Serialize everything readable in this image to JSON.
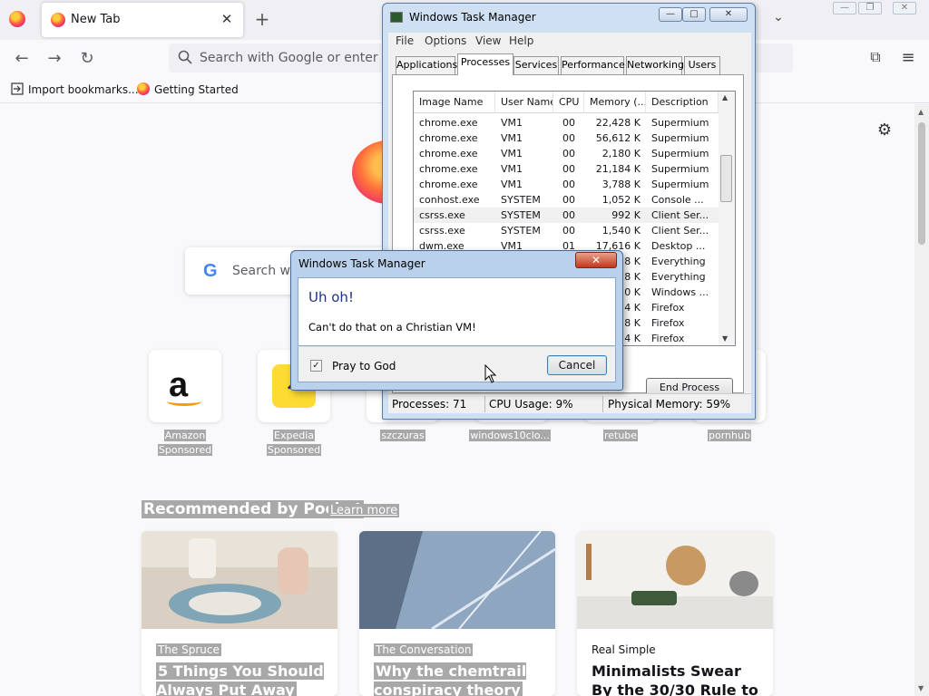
{
  "browser": {
    "tab": {
      "title": "New Tab",
      "close_icon": "close-icon"
    },
    "urlbar": {
      "placeholder": "Search with Google or enter addr"
    },
    "bookmarks": [
      {
        "label": "Import bookmarks...",
        "icon": "import-icon"
      },
      {
        "label": "Getting Started",
        "icon": "firefox-icon"
      }
    ]
  },
  "newtab": {
    "search_placeholder": "Search wi",
    "tiles": [
      {
        "label": "Amazon",
        "sub": "Sponsored"
      },
      {
        "label": "Expedia",
        "sub": "Sponsored"
      },
      {
        "label": "szczuras"
      },
      {
        "label": "windows10clo..."
      },
      {
        "label": "retube"
      },
      {
        "label": "pornhub"
      }
    ],
    "pocket_heading": "Recommended by Pocket",
    "learn_more": "Learn more",
    "cards": [
      {
        "source": "The Spruce",
        "title": "5 Things You Should Always Put Away"
      },
      {
        "source": "The Conversation",
        "title": "Why the chemtrail conspiracy theory"
      },
      {
        "source": "Real Simple",
        "title": "Minimalists Swear By the 30/30 Rule to Cut"
      }
    ]
  },
  "task_manager": {
    "title": "Windows Task Manager",
    "menus": [
      "File",
      "Options",
      "View",
      "Help"
    ],
    "tabs": [
      "Applications",
      "Processes",
      "Services",
      "Performance",
      "Networking",
      "Users"
    ],
    "active_tab": "Processes",
    "columns": [
      "Image Name",
      "User Name",
      "CPU",
      "Memory (...",
      "Description"
    ],
    "rows": [
      [
        "chrome.exe",
        "VM1",
        "00",
        "22,428 K",
        "Supermium"
      ],
      [
        "chrome.exe",
        "VM1",
        "00",
        "56,612 K",
        "Supermium"
      ],
      [
        "chrome.exe",
        "VM1",
        "00",
        "2,180 K",
        "Supermium"
      ],
      [
        "chrome.exe",
        "VM1",
        "00",
        "21,184 K",
        "Supermium"
      ],
      [
        "chrome.exe",
        "VM1",
        "00",
        "3,788 K",
        "Supermium"
      ],
      [
        "conhost.exe",
        "SYSTEM",
        "00",
        "1,052 K",
        "Console ..."
      ],
      [
        "csrss.exe",
        "SYSTEM",
        "00",
        "992 K",
        "Client Ser..."
      ],
      [
        "csrss.exe",
        "SYSTEM",
        "00",
        "1,540 K",
        "Client Ser..."
      ],
      [
        "dwm.exe",
        "VM1",
        "01",
        "17,616 K",
        "Desktop ..."
      ],
      [
        "",
        "",
        "",
        "8 K",
        "Everything"
      ],
      [
        "",
        "",
        "",
        "8 K",
        "Everything"
      ],
      [
        "",
        "",
        "",
        "0 K",
        "Windows ..."
      ],
      [
        "",
        "",
        "",
        "4 K",
        "Firefox"
      ],
      [
        "",
        "",
        "",
        "8 K",
        "Firefox"
      ],
      [
        "",
        "",
        "",
        "4 K",
        "Firefox"
      ]
    ],
    "end_process": "End Process",
    "status": {
      "processes": "Processes: 71",
      "cpu": "CPU Usage: 9%",
      "memory": "Physical Memory: 59%"
    }
  },
  "dialog": {
    "title": "Windows Task Manager",
    "heading": "Uh oh!",
    "message": "Can't do that on a Christian VM!",
    "checkbox_label": "Pray to God",
    "checkbox_checked": true,
    "cancel": "Cancel"
  }
}
